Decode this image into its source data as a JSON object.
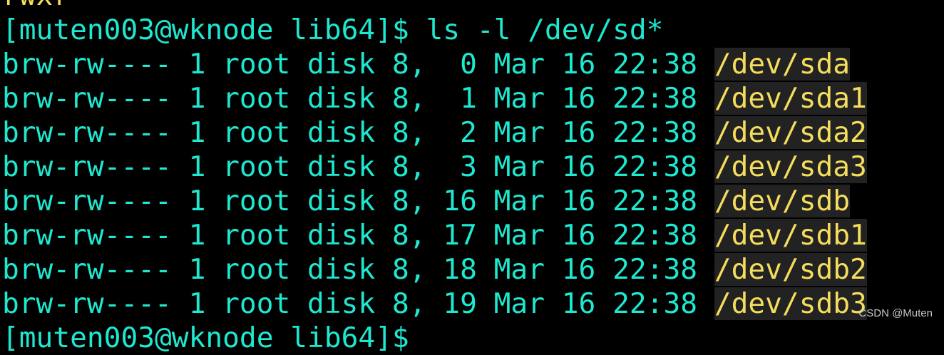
{
  "terminal": {
    "top_partial": "rwxr",
    "prompt": "[muten003@wknode lib64]$ ls -l /dev/sd*",
    "entries": [
      {
        "meta": "brw-rw---- 1 root disk 8,  0 Mar 16 22:38 ",
        "path": "/dev/sda"
      },
      {
        "meta": "brw-rw---- 1 root disk 8,  1 Mar 16 22:38 ",
        "path": "/dev/sda1"
      },
      {
        "meta": "brw-rw---- 1 root disk 8,  2 Mar 16 22:38 ",
        "path": "/dev/sda2"
      },
      {
        "meta": "brw-rw---- 1 root disk 8,  3 Mar 16 22:38 ",
        "path": "/dev/sda3"
      },
      {
        "meta": "brw-rw---- 1 root disk 8, 16 Mar 16 22:38 ",
        "path": "/dev/sdb"
      },
      {
        "meta": "brw-rw---- 1 root disk 8, 17 Mar 16 22:38 ",
        "path": "/dev/sdb1"
      },
      {
        "meta": "brw-rw---- 1 root disk 8, 18 Mar 16 22:38 ",
        "path": "/dev/sdb2"
      },
      {
        "meta": "brw-rw---- 1 root disk 8, 19 Mar 16 22:38 ",
        "path": "/dev/sdb3"
      }
    ],
    "bottom_partial": "[muten003@wknode lib64]$"
  },
  "watermark": "CSDN @Muten",
  "colors": {
    "background": "#000000",
    "text": "#1ee8d0",
    "path": "#f5dd5c"
  }
}
